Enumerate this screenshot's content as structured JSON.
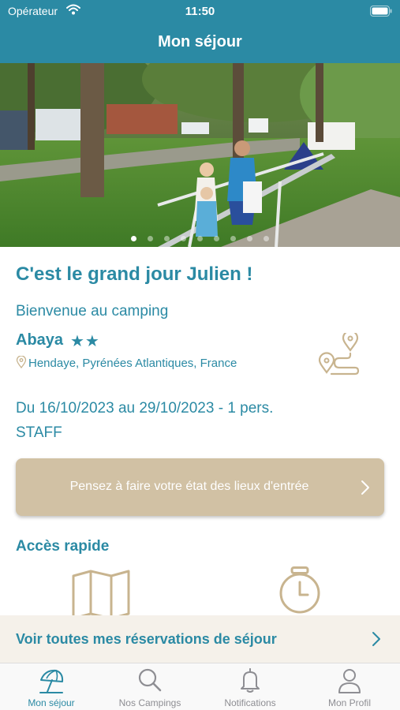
{
  "status_bar": {
    "carrier": "Opérateur",
    "time": "11:50"
  },
  "header": {
    "title": "Mon séjour"
  },
  "hero": {
    "slides_count": 9,
    "active_slide": 1
  },
  "stay": {
    "headline": "C'est le grand jour Julien !",
    "welcome": "Bienvenue au camping",
    "camping_name": "Abaya",
    "stars": "★★",
    "location": "Hendaye, Pyrénées Atlantiques, France",
    "dates": "Du 16/10/2023 au 29/10/2023 - 1 pers.",
    "category": "STAFF"
  },
  "checkin": {
    "label": "Pensez à faire votre état des lieux d'entrée"
  },
  "quick_access": {
    "title": "Accès rapide"
  },
  "reservations": {
    "label": "Voir toutes mes réservations de séjour"
  },
  "tabs": [
    {
      "label": "Mon séjour",
      "icon": "beach-umbrella-icon",
      "active": true
    },
    {
      "label": "Nos Campings",
      "icon": "search-icon",
      "active": false
    },
    {
      "label": "Notifications",
      "icon": "bell-icon",
      "active": false
    },
    {
      "label": "Mon Profil",
      "icon": "user-icon",
      "active": false
    }
  ],
  "colors": {
    "primary": "#2b8aa4",
    "sand": "#d1c1a4",
    "tab_inactive": "#8e8e93"
  }
}
